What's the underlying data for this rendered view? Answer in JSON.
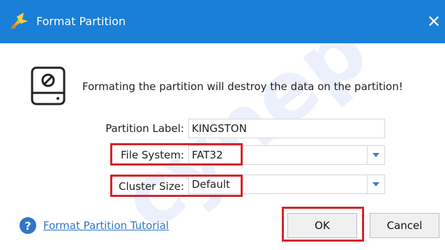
{
  "window": {
    "title": "Format Partition"
  },
  "message": "Formating the partition will destroy the data on the partition!",
  "form": {
    "partition_label": {
      "label": "Partition Label:",
      "value": "KINGSTON"
    },
    "file_system": {
      "label": "File System:",
      "value": "FAT32"
    },
    "cluster_size": {
      "label": "Cluster Size:",
      "value": "Default"
    }
  },
  "footer": {
    "tutorial_link": "Format Partition Tutorial",
    "ok_label": "OK",
    "cancel_label": "Cancel"
  },
  "colors": {
    "titlebar": "#1a7fd6",
    "highlight": "#d5242b",
    "link": "#2f77c4"
  },
  "icons": [
    "app-logo-icon",
    "close-icon",
    "disk-warning-icon",
    "chevron-down-icon",
    "help-icon"
  ]
}
